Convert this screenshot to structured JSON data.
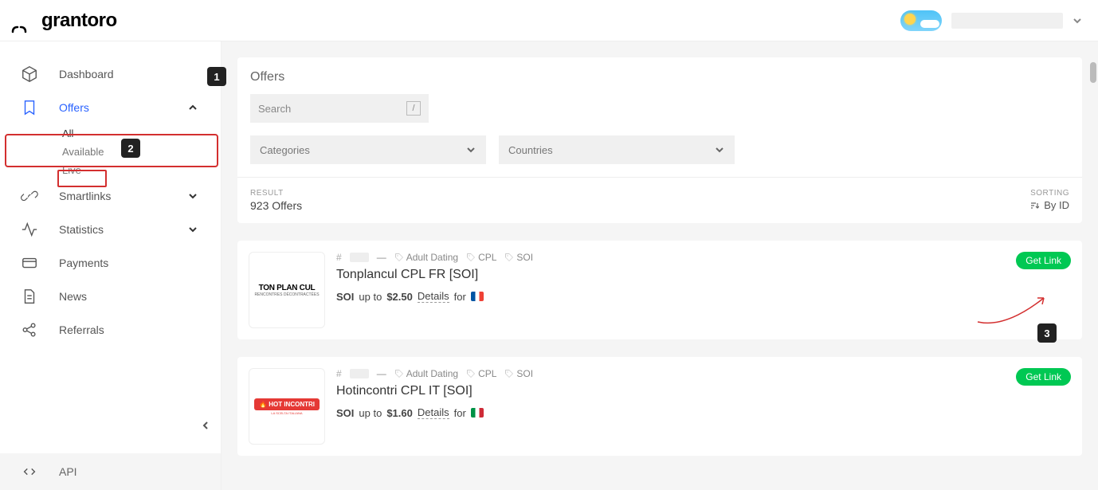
{
  "brand": "grantoro",
  "sidebar": {
    "items": [
      {
        "label": "Dashboard",
        "icon": "cube"
      },
      {
        "label": "Offers",
        "icon": "bookmark",
        "expanded": true,
        "active": true
      },
      {
        "label": "Smartlinks",
        "icon": "link",
        "expandable": true
      },
      {
        "label": "Statistics",
        "icon": "activity",
        "expandable": true
      },
      {
        "label": "Payments",
        "icon": "card"
      },
      {
        "label": "News",
        "icon": "file"
      },
      {
        "label": "Referrals",
        "icon": "share"
      }
    ],
    "offers_sub": [
      {
        "label": "All",
        "active": true
      },
      {
        "label": "Available"
      },
      {
        "label": "Live"
      }
    ],
    "api_label": "API"
  },
  "annotations": {
    "b1": "1",
    "b2": "2",
    "b3": "3"
  },
  "filters": {
    "title": "Offers",
    "search_placeholder": "Search",
    "search_key": "/",
    "categories_label": "Categories",
    "countries_label": "Countries",
    "result_label": "RESULT",
    "result_value": "923 Offers",
    "sorting_label": "SORTING",
    "sorting_value": "By ID"
  },
  "offers": [
    {
      "id_prefix": "#",
      "tags": [
        "Adult Dating",
        "CPL",
        "SOI"
      ],
      "title": "Tonplancul CPL FR [SOI]",
      "payout_bold": "SOI",
      "payout_mid": "up to",
      "payout_val": "$2.50",
      "details": "Details",
      "for": "for",
      "flag": "fr",
      "button": "Get Link",
      "thumb_line1": "TON PLAN CUL",
      "thumb_line2": "RENCONTRES DÉCONTRACTÉES"
    },
    {
      "id_prefix": "#",
      "tags": [
        "Adult Dating",
        "CPL",
        "SOI"
      ],
      "title": "Hotincontri CPL IT [SOI]",
      "payout_bold": "SOI",
      "payout_mid": "up to",
      "payout_val": "$1.60",
      "details": "Details",
      "for": "for",
      "flag": "it",
      "button": "Get Link",
      "thumb_line1": "HOT INCONTRI",
      "thumb_line2": "LA SCELTA ITALIANA"
    }
  ]
}
